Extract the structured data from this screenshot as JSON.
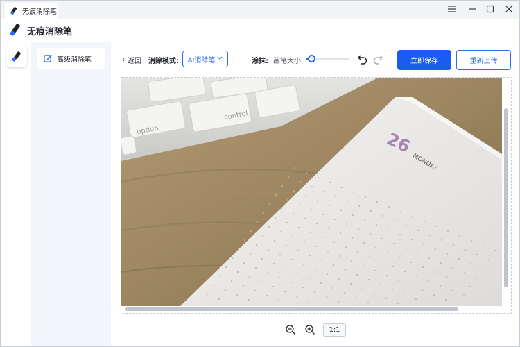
{
  "titlebar": {
    "tab_title": "无痕消除笔",
    "controls": {
      "menu_icon": "hamburger-icon",
      "minimize_icon": "minimize-icon",
      "maximize_icon": "maximize-icon",
      "close_icon": "close-icon"
    }
  },
  "header": {
    "app_title": "无痕消除笔",
    "logo_icon": "eraser-pen-icon"
  },
  "rail": {
    "items": [
      {
        "icon": "eraser-pen-icon"
      }
    ]
  },
  "sidemenu": {
    "items": [
      {
        "label": "高级消除笔",
        "icon": "edit-icon",
        "active": true
      }
    ]
  },
  "toolbar": {
    "back_label": "返回",
    "mode_label": "消除模式:",
    "mode_value": "AI消除笔",
    "smear_label": "涂抹:",
    "brush_size_label": "画笔大小",
    "brush_size_level": 0.12,
    "undo_icon": "undo-icon",
    "redo_icon": "redo-icon",
    "save_label": "立即保存",
    "reupload_label": "重新上传"
  },
  "canvas": {
    "image_content": {
      "date_number": "26",
      "weekday": "MONDAY",
      "key_labels": [
        "option",
        "control"
      ]
    }
  },
  "zoom": {
    "zoom_out_icon": "zoom-out-icon",
    "zoom_in_icon": "zoom-in-icon",
    "ratio_label": "1:1"
  },
  "colors": {
    "accent": "#1a5cf0",
    "sidemenu_bg": "#f2f5fa",
    "titlebar_bg": "#f3f4f6"
  }
}
